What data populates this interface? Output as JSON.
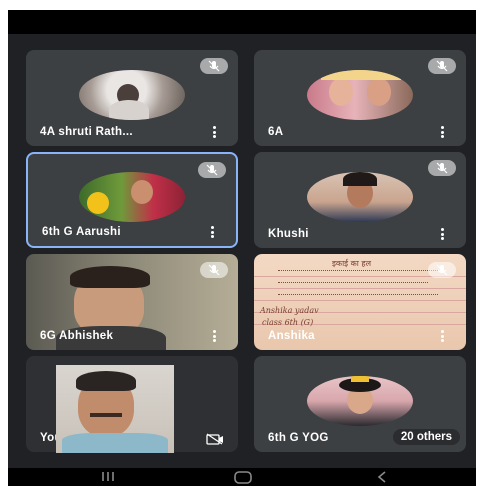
{
  "tiles": [
    {
      "name": "4A shruti Rath...",
      "muted": true
    },
    {
      "name": "6A",
      "muted": true
    },
    {
      "name": "6th G Aarushi",
      "muted": true,
      "active": true
    },
    {
      "name": "Khushi",
      "muted": true
    },
    {
      "name": "6G Abhishek",
      "muted": true
    },
    {
      "name": "Anshika",
      "muted": true
    },
    {
      "name": "You",
      "muted": false
    },
    {
      "name": "6th G YOG",
      "muted": false
    }
  ],
  "others_label": "20 others",
  "note": {
    "line1": "इकाई का हल",
    "line2": "Anshika yadav",
    "line3": "class 6th (G)"
  },
  "icons": {
    "mic_off": "mic-off-icon",
    "more": "more-vert-icon",
    "self_view": "self-view-icon",
    "nav_recents": "recents-icon",
    "nav_home": "home-icon",
    "nav_back": "back-icon"
  }
}
